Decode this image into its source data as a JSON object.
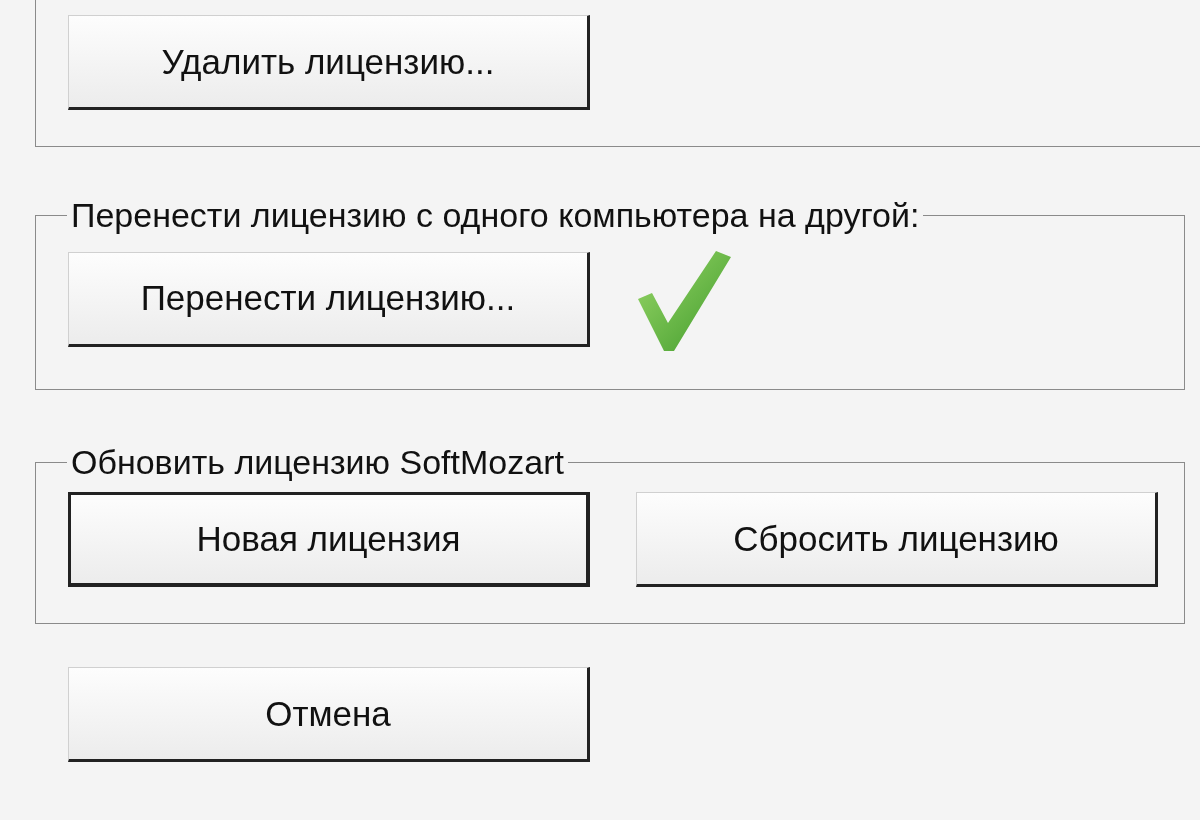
{
  "groups": [
    {
      "buttons": [
        {
          "label": "Удалить лицензию...",
          "default": false
        }
      ]
    },
    {
      "legend": "Перенести лицензию с одного компьютера на другой:",
      "done": true,
      "buttons": [
        {
          "label": "Перенести лицензию...",
          "default": false
        }
      ]
    },
    {
      "legend": "Обновить лицензию SoftMozart",
      "buttons": [
        {
          "label": "Новая лицензия",
          "default": true
        },
        {
          "label": "Сбросить лицензию",
          "default": false
        }
      ]
    }
  ],
  "buttons": [
    {
      "label": "Отмена",
      "default": false
    }
  ]
}
